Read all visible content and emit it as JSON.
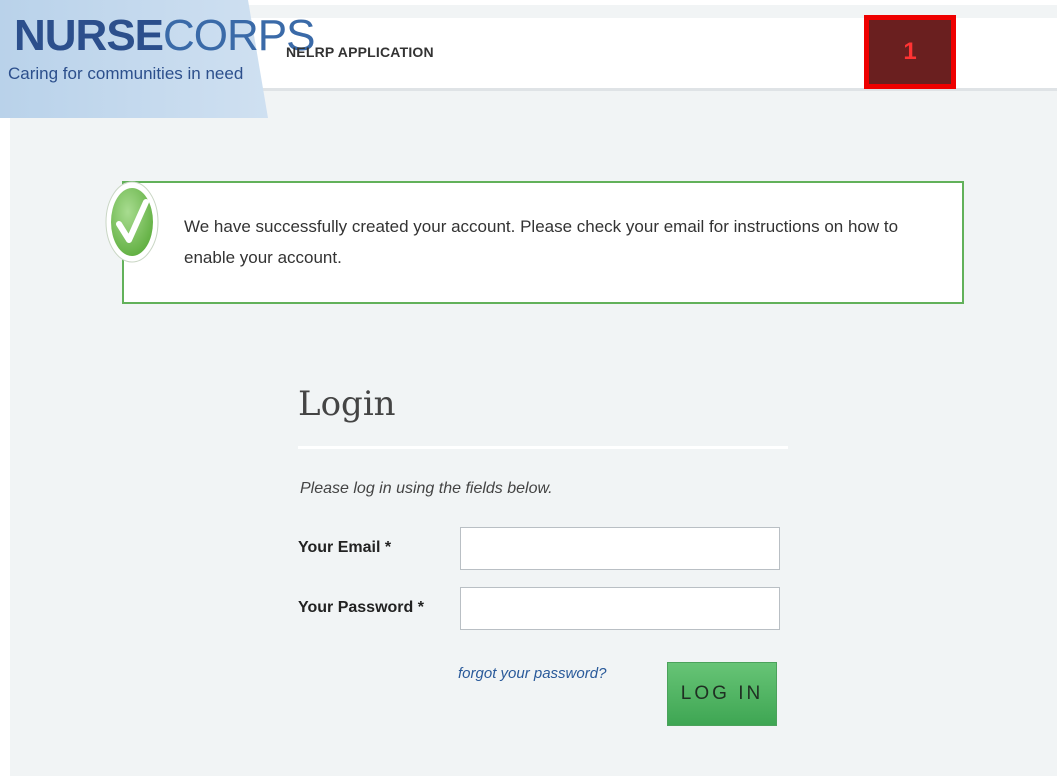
{
  "header": {
    "logo_title_bold": "NURSE",
    "logo_title_light": "CORPS",
    "logo_tagline": "Caring for communities in need",
    "app_title": "NELRP APPLICATION",
    "badge_label": "1"
  },
  "alert": {
    "message": "We have successfully created your account. Please check your email for instructions on how to enable your account.",
    "icon": "check-circle-icon",
    "accent_color": "#62b15a"
  },
  "login": {
    "title": "Login",
    "subtitle": "Please log in using the fields below.",
    "email_label": "Your Email *",
    "email_value": "",
    "password_label": "Your Password *",
    "password_value": "",
    "forgot_link": "forgot your password?",
    "submit_label": "LOG IN",
    "button_color": "#4cb460"
  }
}
